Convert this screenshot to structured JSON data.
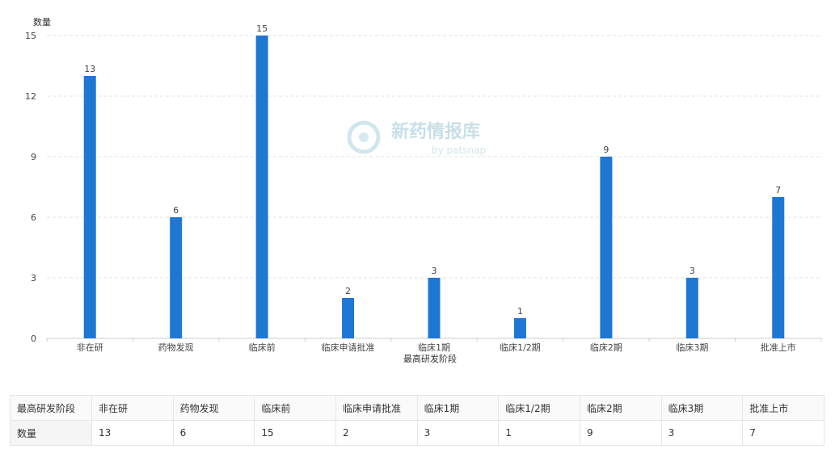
{
  "chart_data": {
    "type": "bar",
    "ylabel": "数量",
    "xlabel": "最高研发阶段",
    "categories": [
      "非在研",
      "药物发现",
      "临床前",
      "临床申请批准",
      "临床1期",
      "临床1/2期",
      "临床2期",
      "临床3期",
      "批准上市"
    ],
    "values": [
      13,
      6,
      15,
      2,
      3,
      1,
      9,
      3,
      7
    ],
    "ylim": [
      0,
      15
    ],
    "yticks": [
      0,
      3,
      6,
      9,
      12,
      15
    ],
    "grid": true,
    "bar_color": "#1f77d4"
  },
  "watermark": {
    "title": "新药情报库",
    "subtitle": "by patsnap"
  },
  "table": {
    "header_label": "最高研发阶段",
    "row_label": "数量"
  }
}
